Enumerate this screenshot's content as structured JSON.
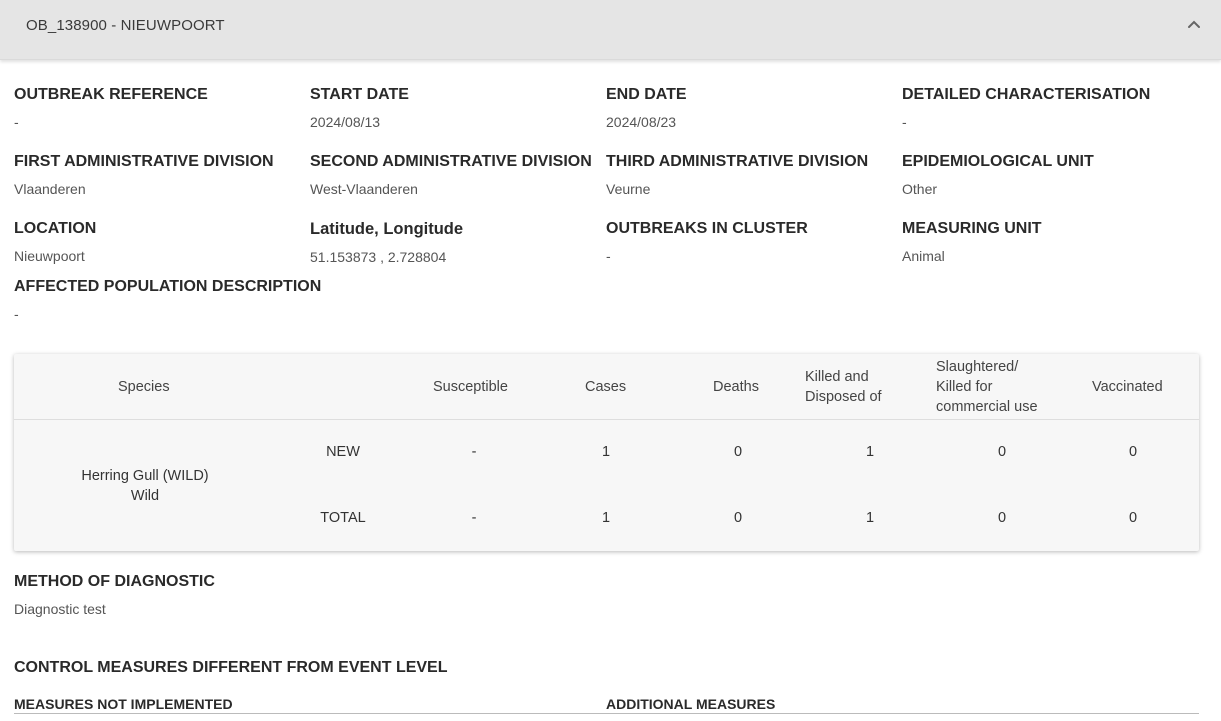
{
  "header": {
    "title": "OB_138900 - NIEUWPOORT"
  },
  "fields": {
    "outbreak_reference": {
      "label": "OUTBREAK REFERENCE",
      "value": "-"
    },
    "start_date": {
      "label": "START DATE",
      "value": "2024/08/13"
    },
    "end_date": {
      "label": "END DATE",
      "value": "2024/08/23"
    },
    "detailed_characterisation": {
      "label": "DETAILED CHARACTERISATION",
      "value": "-"
    },
    "first_admin_division": {
      "label": "FIRST ADMINISTRATIVE DIVISION",
      "value": "Vlaanderen"
    },
    "second_admin_division": {
      "label": "SECOND ADMINISTRATIVE DIVISION",
      "value": "West-Vlaanderen"
    },
    "third_admin_division": {
      "label": "THIRD ADMINISTRATIVE DIVISION",
      "value": "Veurne"
    },
    "epidemiological_unit": {
      "label": "EPIDEMIOLOGICAL UNIT",
      "value": "Other"
    },
    "location": {
      "label": "LOCATION",
      "value": "Nieuwpoort"
    },
    "lat_long": {
      "label": "Latitude, Longitude",
      "value": "51.153873 , 2.728804"
    },
    "outbreaks_in_cluster": {
      "label": "OUTBREAKS IN CLUSTER",
      "value": "-"
    },
    "measuring_unit": {
      "label": "MEASURING UNIT",
      "value": "Animal"
    },
    "affected_population": {
      "label": "AFFECTED POPULATION DESCRIPTION",
      "value": "-"
    }
  },
  "table": {
    "headers": {
      "species": "Species",
      "susceptible": "Susceptible",
      "cases": "Cases",
      "deaths": "Deaths",
      "killed_disposed": [
        "Killed and",
        "Disposed of"
      ],
      "slaughtered": [
        "Slaughtered/",
        "Killed for",
        "commercial use"
      ],
      "vaccinated": "Vaccinated"
    },
    "species_name": [
      "Herring Gull (WILD)",
      "Wild"
    ],
    "rows": [
      {
        "type": "NEW",
        "susceptible": "-",
        "cases": "1",
        "deaths": "0",
        "killed_disposed": "1",
        "slaughtered": "0",
        "vaccinated": "0"
      },
      {
        "type": "TOTAL",
        "susceptible": "-",
        "cases": "1",
        "deaths": "0",
        "killed_disposed": "1",
        "slaughtered": "0",
        "vaccinated": "0"
      }
    ]
  },
  "method_of_diagnostic": {
    "label": "METHOD OF DIAGNOSTIC",
    "value": "Diagnostic test"
  },
  "control_measures": {
    "title": "CONTROL MEASURES DIFFERENT FROM EVENT LEVEL",
    "not_implemented_label": "MEASURES NOT IMPLEMENTED",
    "additional_label": "ADDITIONAL MEASURES"
  },
  "icons": {
    "collapse": "chevron-up-icon"
  },
  "colors": {
    "header_bg": "#e5e5e5",
    "table_bg": "#f7f7f7",
    "text": "#333333"
  }
}
